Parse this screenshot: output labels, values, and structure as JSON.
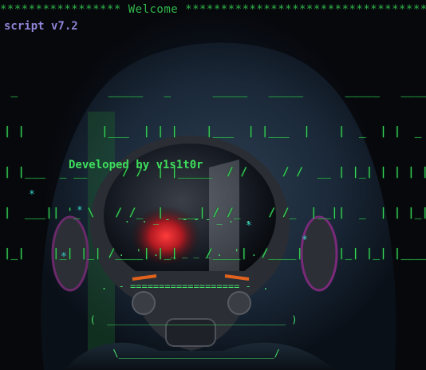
{
  "terminal": {
    "welcome_line": "***************** Welcome *****************************************",
    "version_line": "script v7.2",
    "banner_lines": [
      "  _             _____   _      _____   _____      _____   _____",
      " | |           |___  | | |    |___  | |___  |    |  _  | |  _  |",
      " | |___  _ __     / /  | |_____  / /     / /  __ | |_| | | | | |",
      " |  ___|| '_ \\   / /_  |  ___| / /_    / /_  |__||  _  | | |_| |",
      " |_|    |_| |_| /____| |_|    /____|  /____|     |_| |_| |_____|"
    ],
    "developer_line": "Developed by v1s1t0r",
    "ship_lines": [
      "        .  . _ -  - - - _ .  .",
      "       .  '  .  _ _ _ _ .  '  .",
      "    .  - =================== -  .",
      "  (  _______________________________ )",
      "      \\___________________________/"
    ],
    "stars": [
      "*",
      "*",
      "*",
      "*",
      "*"
    ]
  },
  "colors": {
    "background": "#07080c",
    "welcome_text": "#2fb84a",
    "version_text": "#8f84d6",
    "banner_text": "#38d85a",
    "star_text": "#37d4c9",
    "visor_glow": "#d6202a"
  },
  "icons": {
    "artwork": "hooded-figure-gas-mask-illustration"
  }
}
